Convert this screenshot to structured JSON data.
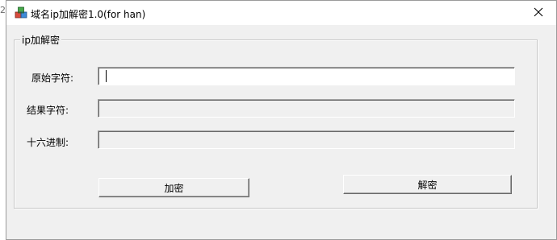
{
  "window": {
    "title": "域名ip加解密1.0(for han)",
    "close_symbol": "✕",
    "icon": "app-icon"
  },
  "desktop": {
    "sliver_text": "2"
  },
  "group": {
    "legend": "ip加解密",
    "fields": [
      {
        "label": "原始字符:",
        "value": "",
        "placeholder": "",
        "state": "active"
      },
      {
        "label": "结果字符:",
        "value": "",
        "placeholder": "",
        "state": "readonly"
      },
      {
        "label": "十六进制:",
        "value": "",
        "placeholder": "",
        "state": "readonly"
      }
    ]
  },
  "buttons": {
    "encrypt_label": "加密",
    "decrypt_label": "解密"
  }
}
